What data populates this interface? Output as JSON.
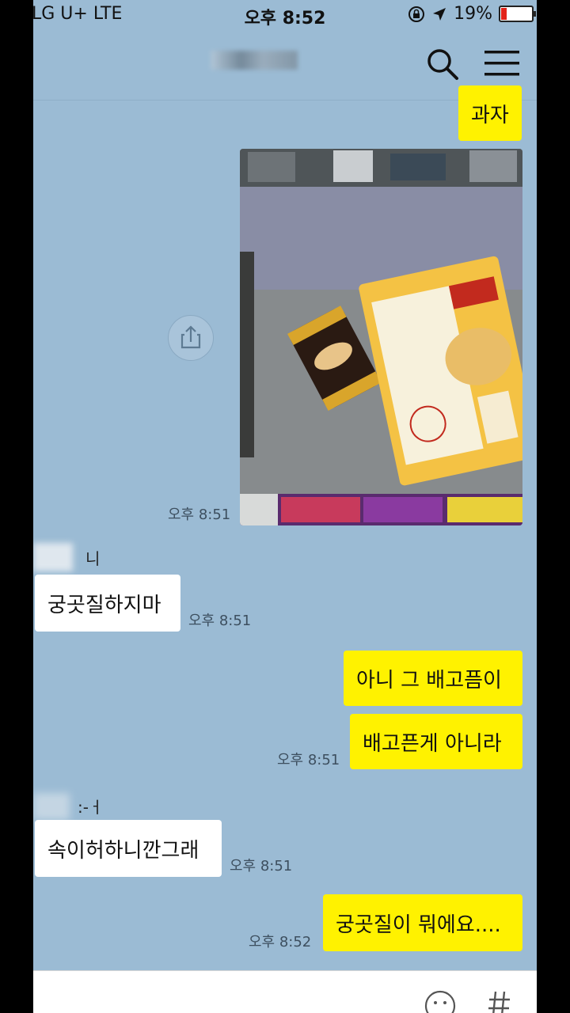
{
  "status": {
    "carrier": "LG U+  LTE",
    "time": "오후 8:52",
    "battery": "19%"
  },
  "header": {
    "icons": [
      "search-icon",
      "menu-icon"
    ]
  },
  "messages": [
    {
      "side": "me",
      "text": "과자"
    },
    {
      "side": "me",
      "type": "photo",
      "time": "오후 8:51"
    },
    {
      "side": "other",
      "sender": "니",
      "text": "궁곳질하지마",
      "time": "오후 8:51"
    },
    {
      "side": "me",
      "text": "아니 그 배고픔이"
    },
    {
      "side": "me",
      "text": "배고픈게 아니라",
      "time": "오후 8:51"
    },
    {
      "side": "other",
      "sender": ":-ㅓ",
      "text": "속이허하니깐그래",
      "time": "오후 8:51"
    },
    {
      "side": "me",
      "text": "궁곳질이 뭐에요....",
      "time": "오후 8:52"
    }
  ],
  "colors": {
    "chat_bg": "#9bbbd4",
    "my_bubble": "#fff200",
    "their_bubble": "#ffffff"
  }
}
